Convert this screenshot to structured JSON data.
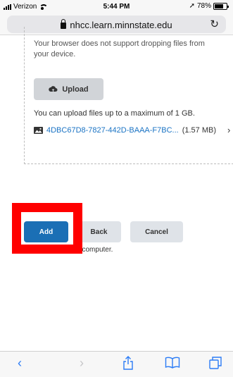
{
  "status_bar": {
    "carrier": "Verizon",
    "time": "5:44 PM",
    "battery_text": "78%",
    "battery_level": 0.78
  },
  "browser": {
    "url": "nhcc.learn.minnstate.edu"
  },
  "dropzone": {
    "not_supported_text": "Your browser does not support dropping files from your device.",
    "upload_label": "Upload",
    "limit_text": "You can upload files up to a maximum of 1 GB.",
    "file_name": "4DBC67D8-7827-442D-BAAA-F7BC...",
    "file_size": "(1.57 MB)"
  },
  "actions": {
    "add_label": "Add",
    "back_label": "Back",
    "cancel_label": "Cancel",
    "below_text": "pload files fro  your computer."
  },
  "colors": {
    "primary": "#1b6fb5",
    "highlight": "#ff0000",
    "ios_blue": "#2b7cf6"
  }
}
